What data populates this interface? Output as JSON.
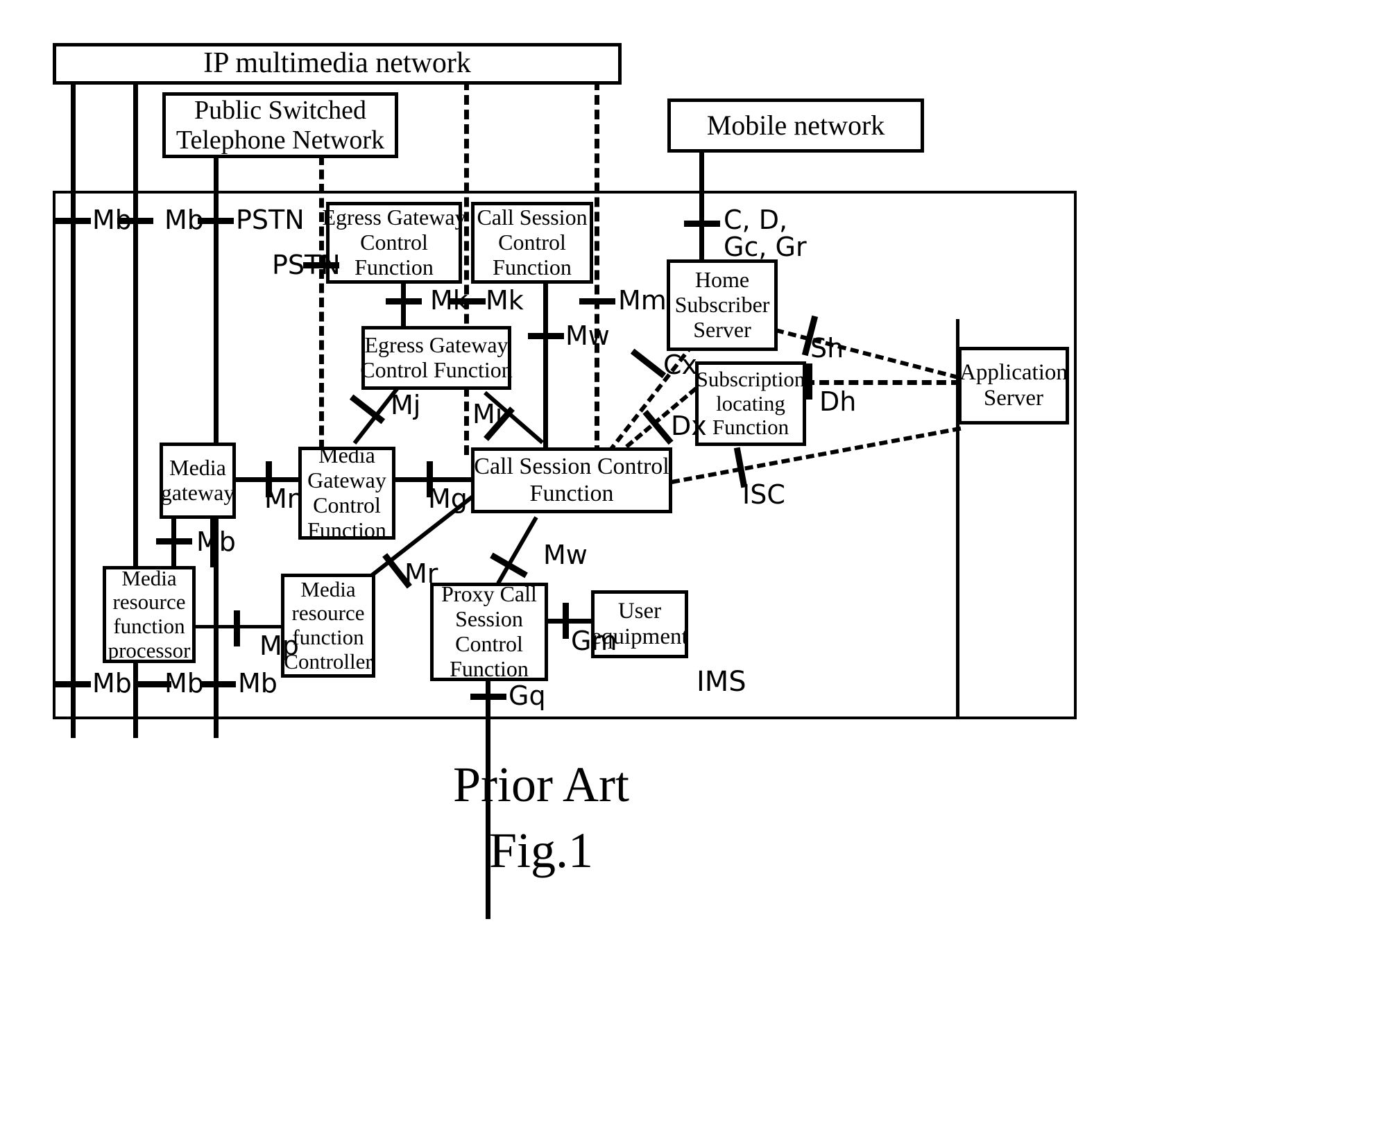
{
  "figure": {
    "prior_art": "Prior Art",
    "fig_number": "Fig.1"
  },
  "nodes": {
    "ip_multimedia_network": "IP multimedia network",
    "pstn_network_line1": "Public Switched",
    "pstn_network_line2": "Telephone Network",
    "mobile_network": "Mobile network",
    "egress_gw_ctrl_top_line1": "Egress Gateway",
    "egress_gw_ctrl_top_line2": "Control",
    "egress_gw_ctrl_top_line3": "Function",
    "call_session_ctrl_top_line1": "Call Session",
    "call_session_ctrl_top_line2": "Control",
    "call_session_ctrl_top_line3": "Function",
    "home_subscriber_server_line1": "Home",
    "home_subscriber_server_line2": "Subscriber",
    "home_subscriber_server_line3": "Server",
    "egress_gw_ctrl_mid_line1": "Egress Gateway",
    "egress_gw_ctrl_mid_line2": "Control Function",
    "subscription_locating_line1": "Subscription",
    "subscription_locating_line2": "locating",
    "subscription_locating_line3": "Function",
    "application_server_line1": "Application",
    "application_server_line2": "Server",
    "media_gateway_line1": "Media",
    "media_gateway_line2": "gateway",
    "media_gw_ctrl_line1": "Media",
    "media_gw_ctrl_line2": "Gateway",
    "media_gw_ctrl_line3": "Control",
    "media_gw_ctrl_line4": "Function",
    "call_session_ctrl_mid_line1": "Call Session Control",
    "call_session_ctrl_mid_line2": "Function",
    "media_resource_processor_line1": "Media",
    "media_resource_processor_line2": "resource",
    "media_resource_processor_line3": "function",
    "media_resource_processor_line4": "processor",
    "media_resource_controller_line1": "Media",
    "media_resource_controller_line2": "resource",
    "media_resource_controller_line3": "function",
    "media_resource_controller_line4": "Controller",
    "proxy_call_session_line1": "Proxy Call",
    "proxy_call_session_line2": "Session",
    "proxy_call_session_line3": "Control",
    "proxy_call_session_line4": "Function",
    "user_equipment_line1": "User",
    "user_equipment_line2": "equipment",
    "ims_label": "IMS"
  },
  "reference_points": {
    "mb_top_1": "Mb",
    "mb_top_2": "Mb",
    "pstn_top": "PSTN",
    "pstn_left": "PSTN",
    "c_d": "C, D,",
    "gc_gr": "Gc, Gr",
    "mk_1": "Mk",
    "mk_2": "Mk",
    "mm": "Mm",
    "mw_upper": "Mw",
    "sh": "Sh",
    "cx": "Cx",
    "dh": "Dh",
    "mj": "Mj",
    "mi": "Mi",
    "dx": "Dx",
    "mn": "Mn",
    "mg": "Mg",
    "isc": "ISC",
    "mb_mgw": "Mb",
    "mr": "Mr",
    "mw_lower": "Mw",
    "mp": "Mp",
    "gm": "Gm",
    "mb_bot_1": "Mb",
    "mb_bot_2": "Mb",
    "mb_bot_3": "Mb",
    "gq": "Gq"
  }
}
